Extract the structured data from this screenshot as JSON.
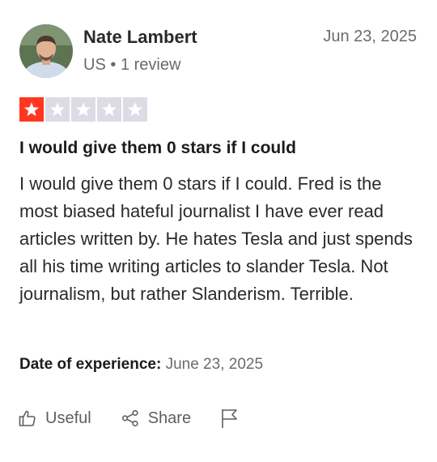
{
  "reviewer": {
    "name": "Nate Lambert",
    "country": "US",
    "separator": "•",
    "review_count": "1 review"
  },
  "review": {
    "date": "Jun 23, 2025",
    "rating": 1,
    "rating_max": 5,
    "star_filled_color": "#ff3722",
    "star_empty_color": "#dcdce6",
    "title": "I would give them 0 stars if I could",
    "body": "I would give them 0 stars if I could. Fred is the most biased hateful journalist I have ever read articles written by. He hates Tesla and just spends all his time writing articles to slander Tesla. Not journalism, but rather Slanderism. Terrible.",
    "experience_label": "Date of experience:",
    "experience_date": "June 23, 2025"
  },
  "actions": {
    "useful_label": "Useful",
    "useful_icon": "thumbs-up-icon",
    "share_label": "Share",
    "share_icon": "share-icon",
    "report_icon": "flag-icon"
  }
}
